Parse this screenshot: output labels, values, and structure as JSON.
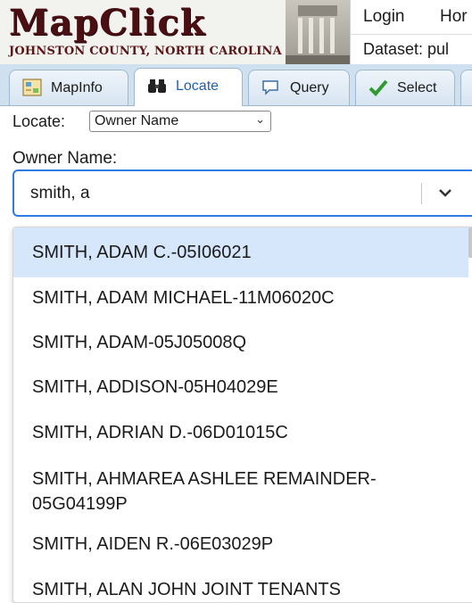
{
  "header": {
    "logo_title": "MapClick",
    "logo_subtitle": "JOHNSTON COUNTY, NORTH CAROLINA",
    "login_label": "Login",
    "home_label": "Hor",
    "dataset_label": "Dataset: pul"
  },
  "tabs": [
    {
      "label": "MapInfo",
      "icon": "map-info-icon",
      "active": false
    },
    {
      "label": "Locate",
      "icon": "binoculars-icon",
      "active": true
    },
    {
      "label": "Query",
      "icon": "speech-bubble-icon",
      "active": false
    },
    {
      "label": "Select",
      "icon": "checkmark-icon",
      "active": false
    }
  ],
  "locate": {
    "label": "Locate:",
    "selected": "Owner Name"
  },
  "owner": {
    "label": "Owner Name:",
    "value": "smith, a"
  },
  "results": [
    "SMITH, ADAM C.-05I06021",
    "SMITH, ADAM MICHAEL-11M06020C",
    "SMITH, ADAM-05J05008Q",
    "SMITH, ADDISON-05H04029E",
    "SMITH, ADRIAN D.-06D01015C",
    "SMITH, AHMAREA ASHLEE REMAINDER-05G04199P",
    "SMITH, AIDEN R.-06E03029P",
    "SMITH, ALAN JOHN JOINT TENANTS"
  ],
  "colors": {
    "accent": "#2d7be5",
    "highlight": "#d6e6fb",
    "logo": "#4a0f12",
    "tabbar": "#cfe0ef"
  }
}
